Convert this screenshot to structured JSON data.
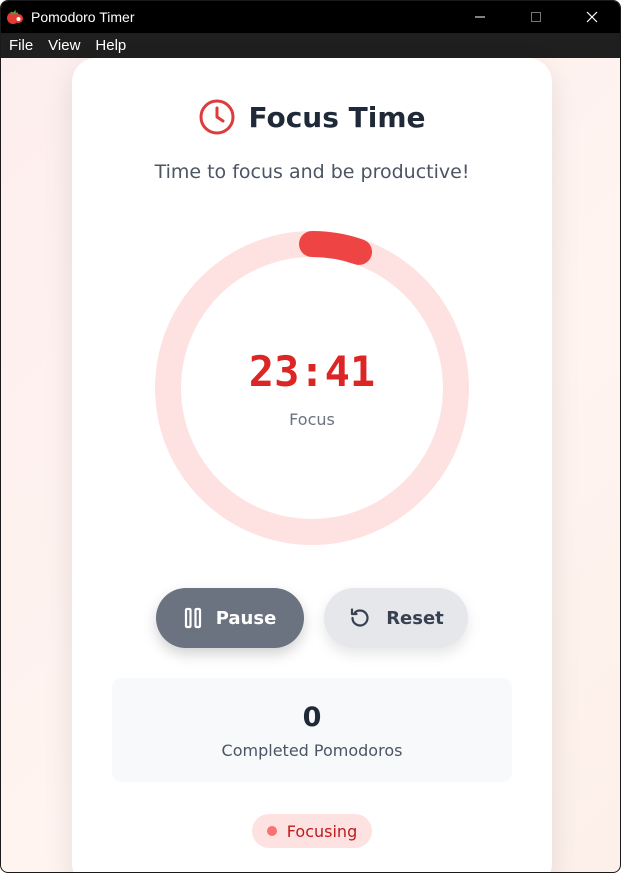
{
  "window": {
    "title": "Pomodoro Timer",
    "app_icon": "tomato-icon",
    "controls": [
      "minimize-icon",
      "maximize-icon",
      "close-icon"
    ]
  },
  "menu": {
    "items": [
      "File",
      "View",
      "Help"
    ]
  },
  "header": {
    "icon": "clock-icon",
    "title": "Focus Time",
    "subtitle": "Time to focus and be productive!"
  },
  "timer": {
    "time": "23:41",
    "mode_label": "Focus",
    "progress_fraction": 0.053,
    "ring_track_color": "#fee2e2",
    "ring_progress_color": "#ef4444"
  },
  "buttons": {
    "pause_label": "Pause",
    "pause_icon": "pause-icon",
    "reset_label": "Reset",
    "reset_icon": "reset-icon"
  },
  "stats": {
    "completed_count": "0",
    "completed_label": "Completed Pomodoros"
  },
  "status": {
    "label": "Focusing",
    "color": "#f87171"
  }
}
